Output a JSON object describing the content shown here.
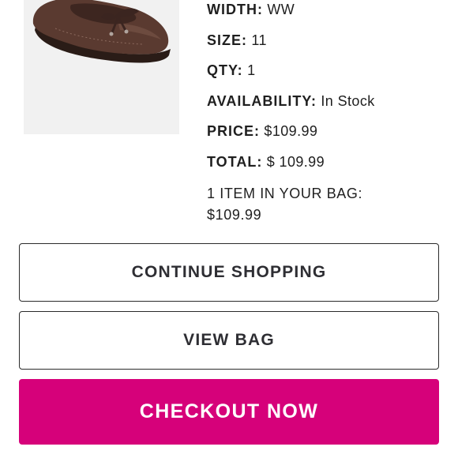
{
  "product": {
    "image_icon": "brown-loafer-shoe"
  },
  "details": [
    {
      "label": "WIDTH:",
      "value": "WW"
    },
    {
      "label": "SIZE:",
      "value": "11"
    },
    {
      "label": "QTY:",
      "value": "1"
    },
    {
      "label": "AVAILABILITY:",
      "value": "In Stock"
    },
    {
      "label": "PRICE:",
      "value": "$109.99"
    },
    {
      "label": "TOTAL:",
      "value": "$ 109.99"
    }
  ],
  "bag_summary": {
    "line1": "1 ITEM IN YOUR BAG:",
    "line2": "$109.99"
  },
  "buttons": {
    "continue_label": "CONTINUE SHOPPING",
    "view_bag_label": "VIEW BAG",
    "checkout_label": "CHECKOUT NOW"
  },
  "colors": {
    "checkout_bg": "#d6017a",
    "text": "#1f1f1f"
  }
}
